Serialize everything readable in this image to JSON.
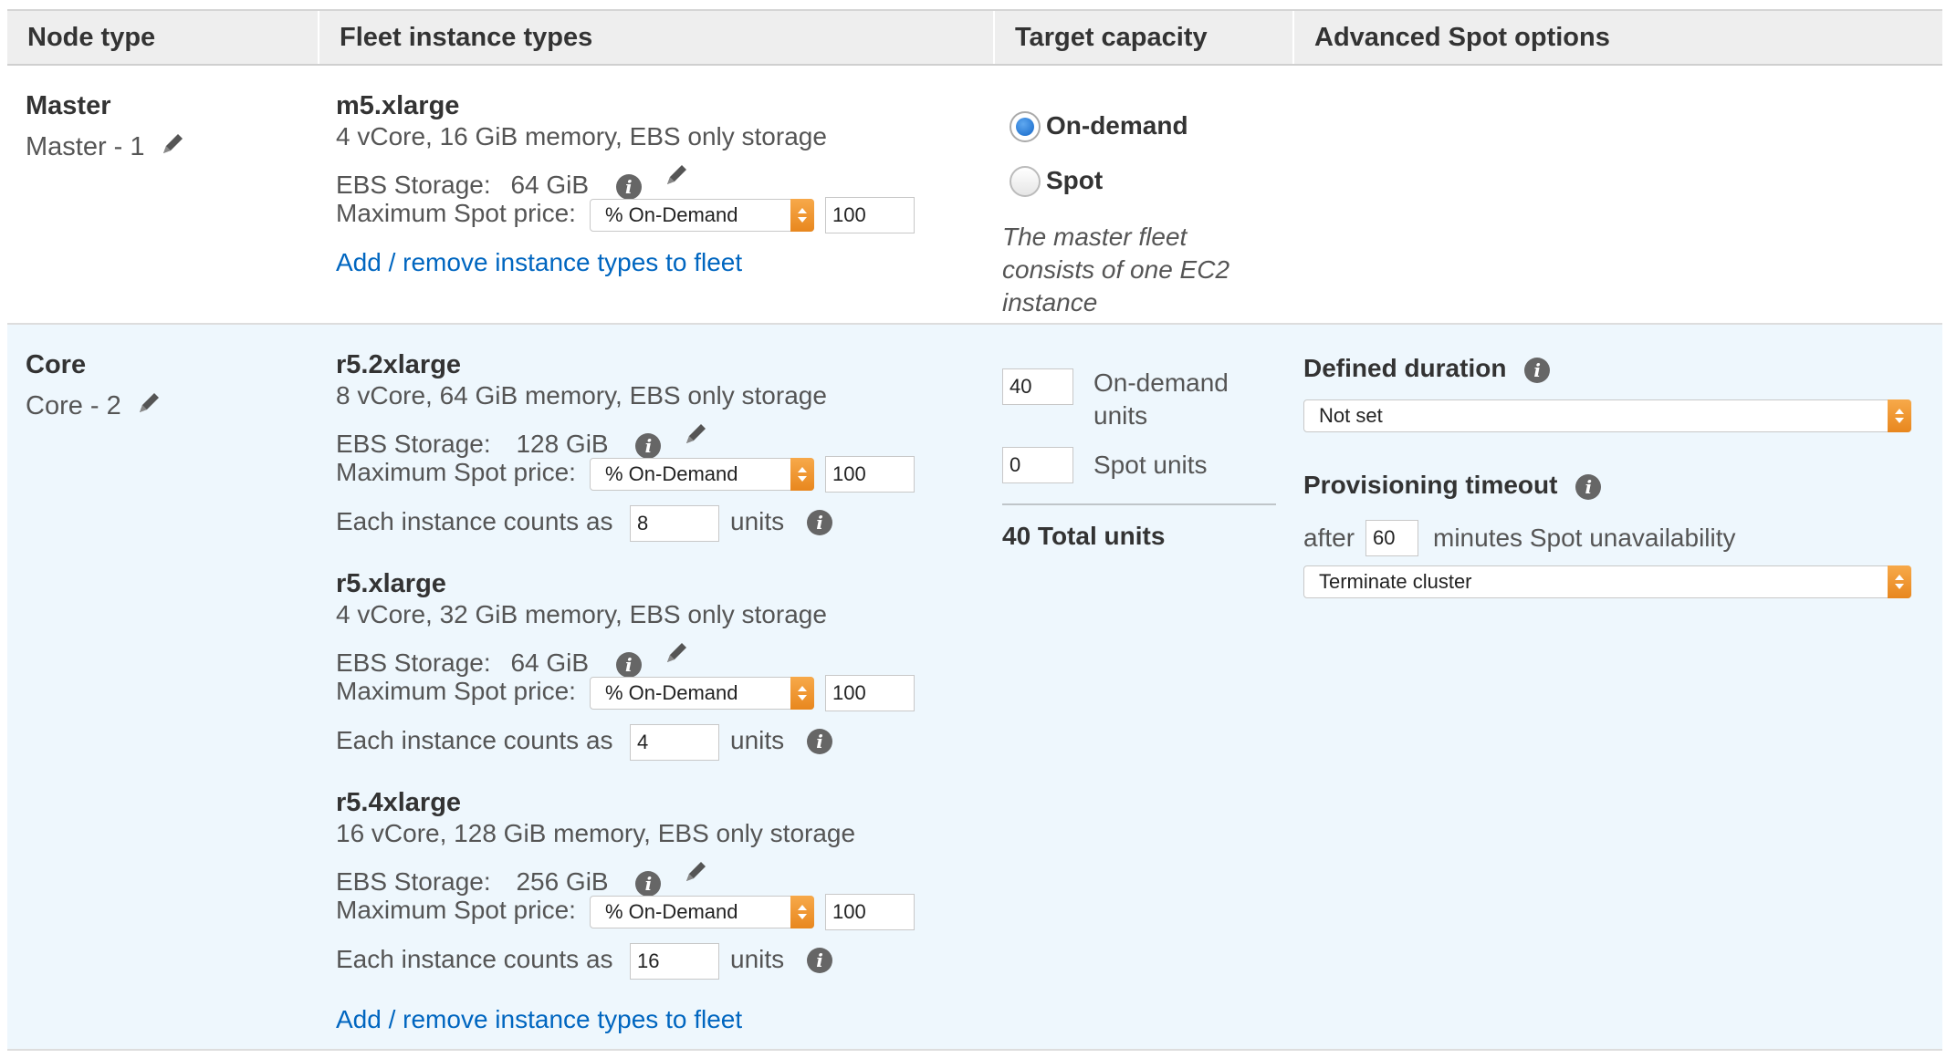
{
  "headers": {
    "node_type": "Node type",
    "fleet_instance_types": "Fleet instance types",
    "target_capacity": "Target capacity",
    "advanced_spot_options": "Advanced Spot options"
  },
  "master": {
    "node_label": "Master",
    "node_name": "Master - 1",
    "instance": {
      "type": "m5.xlarge",
      "spec": "4 vCore, 16 GiB memory, EBS only storage",
      "ebs_label": "EBS Storage:",
      "ebs_value": "64 GiB",
      "spot_price_label": "Maximum Spot price:",
      "spot_price_mode": "% On-Demand",
      "spot_price_value": "100"
    },
    "add_remove_link": "Add / remove instance types to fleet",
    "capacity": {
      "on_demand_label": "On-demand",
      "spot_label": "Spot",
      "selected": "On-demand",
      "note": "The master fleet consists of one EC2 instance"
    }
  },
  "core": {
    "node_label": "Core",
    "node_name": "Core - 2",
    "count_label": "Each instance counts as",
    "units_label": "units",
    "instances": [
      {
        "type": "r5.2xlarge",
        "spec": "8 vCore, 64 GiB memory, EBS only storage",
        "ebs_label": "EBS Storage:",
        "ebs_value": "128 GiB",
        "spot_price_label": "Maximum Spot price:",
        "spot_price_mode": "% On-Demand",
        "spot_price_value": "100",
        "weight": "8"
      },
      {
        "type": "r5.xlarge",
        "spec": "4 vCore, 32 GiB memory, EBS only storage",
        "ebs_label": "EBS Storage:",
        "ebs_value": "64 GiB",
        "spot_price_label": "Maximum Spot price:",
        "spot_price_mode": "% On-Demand",
        "spot_price_value": "100",
        "weight": "4"
      },
      {
        "type": "r5.4xlarge",
        "spec": "16 vCore, 128 GiB memory, EBS only storage",
        "ebs_label": "EBS Storage:",
        "ebs_value": "256 GiB",
        "spot_price_label": "Maximum Spot price:",
        "spot_price_mode": "% On-Demand",
        "spot_price_value": "100",
        "weight": "16"
      }
    ],
    "add_remove_link": "Add / remove instance types to fleet",
    "capacity": {
      "on_demand_value": "40",
      "on_demand_label_1": "On-demand",
      "on_demand_label_2": "units",
      "spot_value": "0",
      "spot_label": "Spot units",
      "total": "40 Total units"
    },
    "spot_options": {
      "defined_duration_label": "Defined duration",
      "defined_duration_value": "Not set",
      "provisioning_timeout_label": "Provisioning timeout",
      "after_label": "after",
      "timeout_minutes": "60",
      "minutes_label": "minutes Spot unavailability",
      "timeout_action": "Terminate cluster"
    }
  },
  "colors": {
    "link": "#0066c0",
    "row_highlight": "#eef7fd",
    "header_bg": "#eeeeee",
    "select_caret": "#f0a040",
    "radio_selected": "#1467c8"
  }
}
